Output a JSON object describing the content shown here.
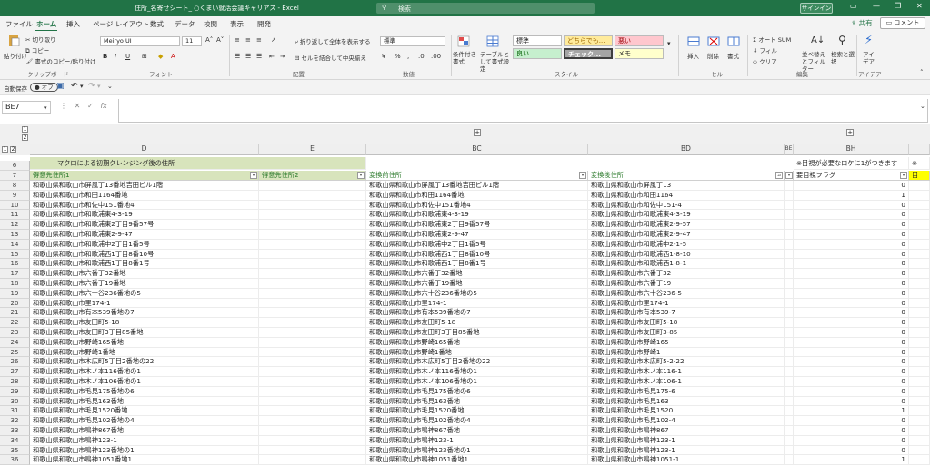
{
  "window": {
    "title": "住所_名寄せシート_ ○くまい就活会議キャリアス - Excel",
    "search_placeholder": "検索",
    "signin": "サインイン"
  },
  "tabs": [
    "ファイル",
    "ホーム",
    "挿入",
    "ページ レイアウト",
    "数式",
    "データ",
    "校閲",
    "表示",
    "開発"
  ],
  "share_label": "共有",
  "comment_label": "コメント",
  "ribbon": {
    "clipboard": {
      "paste": "貼り付け",
      "cut": "切り取り",
      "copy": "コピー",
      "format_painter": "書式のコピー/貼り付け",
      "label": "クリップボード"
    },
    "font": {
      "name": "Meiryo UI",
      "size": "11",
      "label": "フォント",
      "bold": "B",
      "italic": "I",
      "underline": "U"
    },
    "alignment": {
      "wrap": "折り返して全体を表示する",
      "merge": "セルを結合して中央揃え",
      "label": "配置"
    },
    "number": {
      "format": "標準",
      "label": "数値"
    },
    "styles": {
      "conditional": "条件付き書式",
      "table": "テーブルとして書式設定",
      "normal": "標準",
      "neutral": "どちらでも...",
      "bad": "悪い",
      "good": "良い",
      "check": "チェック...",
      "memo": "メモ",
      "label": "スタイル"
    },
    "cells": {
      "insert": "挿入",
      "delete": "削除",
      "format": "書式",
      "label": "セル"
    },
    "editing": {
      "autosum": "オート SUM",
      "fill": "フィル",
      "clear": "クリア",
      "sort": "並べ替えとフィルター",
      "find": "検索と選択",
      "label": "編集"
    },
    "ideas": {
      "label": "アイデア",
      "btn": "アイデア"
    }
  },
  "qat": {
    "autosave": "自動保存",
    "toggle": "オフ"
  },
  "namebox": "BE7",
  "outline_buttons": [
    "1",
    "2"
  ],
  "columns": [
    {
      "id": "D",
      "label": "D"
    },
    {
      "id": "E",
      "label": "E"
    },
    {
      "id": "BC",
      "label": "BC"
    },
    {
      "id": "BD",
      "label": "BD"
    },
    {
      "id": "BE",
      "label": "BE"
    },
    {
      "id": "BH",
      "label": "BH"
    }
  ],
  "row6": {
    "title": "マクロによる初期クレンジング後の住所",
    "note": "※目視が必要なロケに1がつきます",
    "note2": "※"
  },
  "headers": {
    "D": "得意先住所1",
    "E": "得意先住所2",
    "BC": "変換前住所",
    "BD": "変換後住所",
    "BH": "要目視フラグ",
    "BI": "目"
  },
  "rows": [
    {
      "n": "8",
      "d": "和歌山県和歌山市屏風丁13番地吉田ビル1階",
      "bc": "和歌山県和歌山市屏風丁13番地吉田ビル1階",
      "bd": "和歌山県和歌山市屏風丁13",
      "f": "0"
    },
    {
      "n": "9",
      "d": "和歌山県和歌山市和田1164番地",
      "bc": "和歌山県和歌山市和田1164番地",
      "bd": "和歌山県和歌山市和田1164",
      "f": "1"
    },
    {
      "n": "10",
      "d": "和歌山県和歌山市和佐中151番地4",
      "bc": "和歌山県和歌山市和佐中151番地4",
      "bd": "和歌山県和歌山市和佐中151-4",
      "f": "0"
    },
    {
      "n": "11",
      "d": "和歌山県和歌山市和歌浦東4-3-19",
      "bc": "和歌山県和歌山市和歌浦東4-3-19",
      "bd": "和歌山県和歌山市和歌浦東4-3-19",
      "f": "0"
    },
    {
      "n": "12",
      "d": "和歌山県和歌山市和歌浦東2丁目9番57号",
      "bc": "和歌山県和歌山市和歌浦東2丁目9番57号",
      "bd": "和歌山県和歌山市和歌浦東2-9-57",
      "f": "0"
    },
    {
      "n": "13",
      "d": "和歌山県和歌山市和歌浦東2-9-47",
      "bc": "和歌山県和歌山市和歌浦東2-9-47",
      "bd": "和歌山県和歌山市和歌浦東2-9-47",
      "f": "0"
    },
    {
      "n": "14",
      "d": "和歌山県和歌山市和歌浦中2丁目1番5号",
      "bc": "和歌山県和歌山市和歌浦中2丁目1番5号",
      "bd": "和歌山県和歌山市和歌浦中2-1-5",
      "f": "0"
    },
    {
      "n": "15",
      "d": "和歌山県和歌山市和歌浦西1丁目8番10号",
      "bc": "和歌山県和歌山市和歌浦西1丁目8番10号",
      "bd": "和歌山県和歌山市和歌浦西1-8-10",
      "f": "0"
    },
    {
      "n": "16",
      "d": "和歌山県和歌山市和歌浦西1丁目8番1号",
      "bc": "和歌山県和歌山市和歌浦西1丁目8番1号",
      "bd": "和歌山県和歌山市和歌浦西1-8-1",
      "f": "0"
    },
    {
      "n": "17",
      "d": "和歌山県和歌山市六番丁32番地",
      "bc": "和歌山県和歌山市六番丁32番地",
      "bd": "和歌山県和歌山市六番丁32",
      "f": "0"
    },
    {
      "n": "18",
      "d": "和歌山県和歌山市六番丁19番地",
      "bc": "和歌山県和歌山市六番丁19番地",
      "bd": "和歌山県和歌山市六番丁19",
      "f": "0"
    },
    {
      "n": "19",
      "d": "和歌山県和歌山市六十谷236番地の5",
      "bc": "和歌山県和歌山市六十谷236番地の5",
      "bd": "和歌山県和歌山市六十谷236-5",
      "f": "0"
    },
    {
      "n": "20",
      "d": "和歌山県和歌山市里174-1",
      "bc": "和歌山県和歌山市里174-1",
      "bd": "和歌山県和歌山市里174-1",
      "f": "0"
    },
    {
      "n": "21",
      "d": "和歌山県和歌山市有本539番地の7",
      "bc": "和歌山県和歌山市有本539番地の7",
      "bd": "和歌山県和歌山市有本539-7",
      "f": "0"
    },
    {
      "n": "22",
      "d": "和歌山県和歌山市友田町5-18",
      "bc": "和歌山県和歌山市友田町5-18",
      "bd": "和歌山県和歌山市友田町5-18",
      "f": "0"
    },
    {
      "n": "23",
      "d": "和歌山県和歌山市友田町3丁目85番地",
      "bc": "和歌山県和歌山市友田町3丁目85番地",
      "bd": "和歌山県和歌山市友田町3-85",
      "f": "0"
    },
    {
      "n": "24",
      "d": "和歌山県和歌山市野崎165番地",
      "bc": "和歌山県和歌山市野崎165番地",
      "bd": "和歌山県和歌山市野崎165",
      "f": "0"
    },
    {
      "n": "25",
      "d": "和歌山県和歌山市野崎1番地",
      "bc": "和歌山県和歌山市野崎1番地",
      "bd": "和歌山県和歌山市野崎1",
      "f": "0"
    },
    {
      "n": "26",
      "d": "和歌山県和歌山市木広町5丁目2番地の22",
      "bc": "和歌山県和歌山市木広町5丁目2番地の22",
      "bd": "和歌山県和歌山市木広町5-2-22",
      "f": "0"
    },
    {
      "n": "27",
      "d": "和歌山県和歌山市木ノ本116番地の1",
      "bc": "和歌山県和歌山市木ノ本116番地の1",
      "bd": "和歌山県和歌山市木ノ本116-1",
      "f": "0"
    },
    {
      "n": "28",
      "d": "和歌山県和歌山市木ノ本106番地の1",
      "bc": "和歌山県和歌山市木ノ本106番地の1",
      "bd": "和歌山県和歌山市木ノ本106-1",
      "f": "0"
    },
    {
      "n": "29",
      "d": "和歌山県和歌山市毛見175番地の6",
      "bc": "和歌山県和歌山市毛見175番地の6",
      "bd": "和歌山県和歌山市毛見175-6",
      "f": "0"
    },
    {
      "n": "30",
      "d": "和歌山県和歌山市毛見163番地",
      "bc": "和歌山県和歌山市毛見163番地",
      "bd": "和歌山県和歌山市毛見163",
      "f": "0"
    },
    {
      "n": "31",
      "d": "和歌山県和歌山市毛見1520番地",
      "bc": "和歌山県和歌山市毛見1520番地",
      "bd": "和歌山県和歌山市毛見1520",
      "f": "1"
    },
    {
      "n": "32",
      "d": "和歌山県和歌山市毛見102番地の4",
      "bc": "和歌山県和歌山市毛見102番地の4",
      "bd": "和歌山県和歌山市毛見102-4",
      "f": "0"
    },
    {
      "n": "33",
      "d": "和歌山県和歌山市鳴神867番地",
      "bc": "和歌山県和歌山市鳴神867番地",
      "bd": "和歌山県和歌山市鳴神867",
      "f": "0"
    },
    {
      "n": "34",
      "d": "和歌山県和歌山市鳴神123-1",
      "bc": "和歌山県和歌山市鳴神123-1",
      "bd": "和歌山県和歌山市鳴神123-1",
      "f": "0"
    },
    {
      "n": "35",
      "d": "和歌山県和歌山市鳴神123番地の1",
      "bc": "和歌山県和歌山市鳴神123番地の1",
      "bd": "和歌山県和歌山市鳴神123-1",
      "f": "0"
    },
    {
      "n": "36",
      "d": "和歌山県和歌山市鳴神1051番地1",
      "bc": "和歌山県和歌山市鳴神1051番地1",
      "bd": "和歌山県和歌山市鳴神1051-1",
      "f": "1"
    }
  ]
}
